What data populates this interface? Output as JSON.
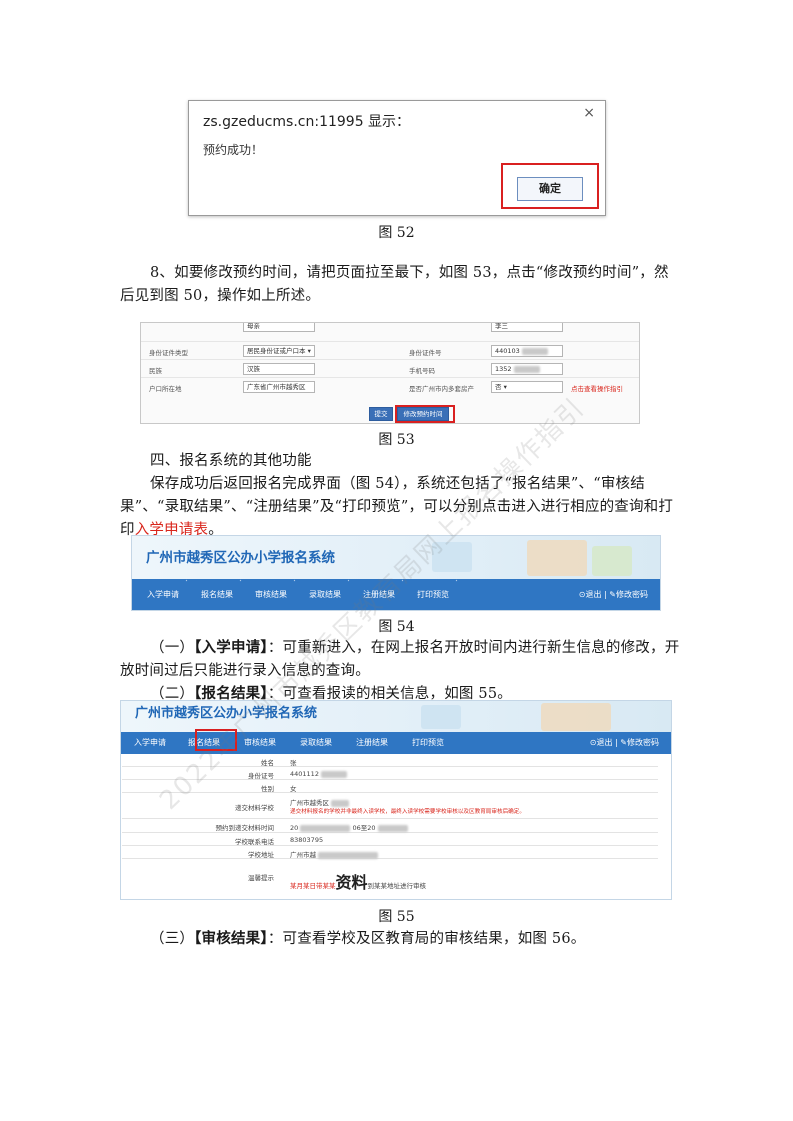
{
  "fig52": {
    "dialog_title": "zs.gzeducms.cn:11995 显示：",
    "close": "×",
    "message": "预约成功！",
    "ok": "确定",
    "caption": "图 52"
  },
  "step8": "8、如要修改预约时间，请把页面拉至最下，如图 53，点击“修改预约时间”，然后见到图 50，操作如上所述。",
  "fig53": {
    "row1": {
      "left_value": "母亲",
      "right_value": "李三"
    },
    "row2": {
      "left_label": "身份证件类型",
      "left_value": "居民身份证或户口本",
      "right_label": "身份证件号",
      "right_value": "440103"
    },
    "row3": {
      "left_label": "民族",
      "left_value": "汉族",
      "right_label": "手机号码",
      "right_value": "1352"
    },
    "row4": {
      "left_label": "户口所在地",
      "left_value": "广东省广州市越秀区",
      "right_label": "是否广州市内多套房产",
      "right_value": "否",
      "hint": "点击查看操作指引"
    },
    "submit": "提交",
    "modify": "修改预约时间",
    "caption": "图 53"
  },
  "section4": {
    "heading": "四、报名系统的其他功能",
    "para_a": "保存成功后返回报名完成界面（图 54），系统还包括了“报名结果”、“审核结果”、“录取结果”、“注册结果”及“打印预览”，可以分别点击进入进行相应的查询和打印",
    "para_link": "入学申请表",
    "para_end": "。"
  },
  "system": {
    "title": "广州市越秀区公办小学报名系统",
    "nav": [
      "入学申请",
      "报名结果",
      "审核结果",
      "录取结果",
      "注册结果",
      "打印预览"
    ],
    "logout": "⊙退出",
    "divider": "|",
    "change_pwd": "✎修改密码"
  },
  "fig54_caption": "图 54",
  "item1": {
    "label": "（一）",
    "bracket": "【入学申请】",
    "text": "：可重新进入，在网上报名开放时间内进行新生信息的修改，开放时间过后只能进行录入信息的查询。"
  },
  "item2": {
    "label": "（二）",
    "bracket": "【报名结果】",
    "text": "：可查看报读的相关信息，如图 55。"
  },
  "fig55": {
    "rows": [
      {
        "label": "姓名",
        "value": "张"
      },
      {
        "label": "身份证号",
        "value": "4401112"
      },
      {
        "label": "性别",
        "value": "女"
      },
      {
        "label": "递交材料学校",
        "value": "广州市越秀区",
        "note": "递交材料报名的学校并非最终入读学校，最终入读学校需要学校审核以及区教育局审核后确定。"
      },
      {
        "label": "预约到递交材料时间",
        "value": "20",
        "value2": "06至20"
      },
      {
        "label": "学校联系电话",
        "value": "83803795"
      },
      {
        "label": "学校地址",
        "value": "广州市越"
      },
      {
        "label": "温馨提示",
        "value_red": "某月某日带某某",
        "value_big": "资料",
        "value_tail": "到某某地址进行审核"
      }
    ],
    "caption": "图 55"
  },
  "item3": {
    "label": "（三）",
    "bracket": "【审核结果】",
    "text": "：可查看学校及区教育局的审核结果，如图 56。"
  },
  "watermark": "2022年广州市越秀区教育局网上报名操作指引"
}
